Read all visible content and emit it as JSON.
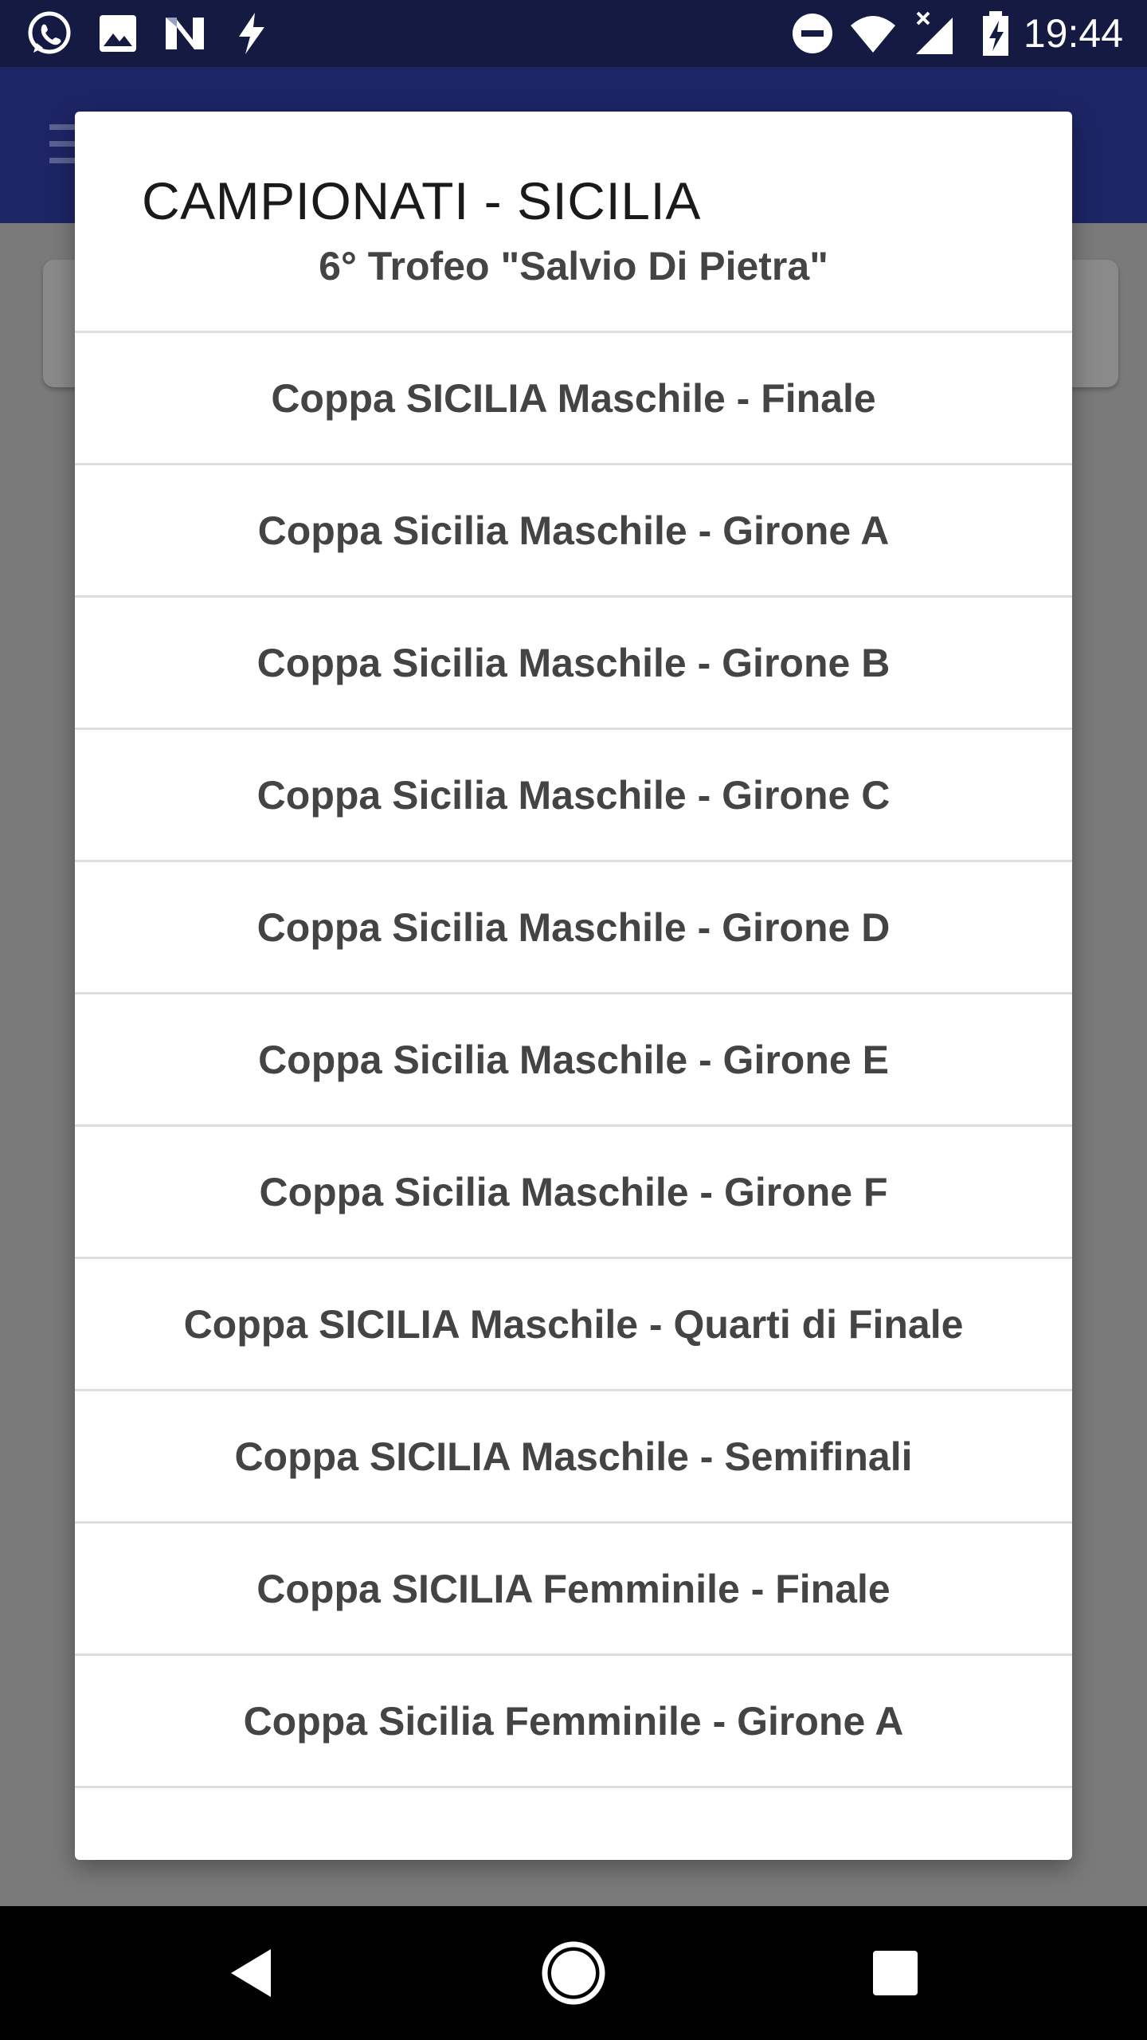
{
  "status_bar": {
    "time": "19:44",
    "left_icons": [
      "whatsapp-icon",
      "image-icon",
      "n-app-icon",
      "flash-icon"
    ],
    "right_icons": [
      "do-not-disturb-icon",
      "wifi-icon",
      "signal-icon",
      "battery-charging-icon"
    ]
  },
  "dialog": {
    "title": "CAMPIONATI - SICILIA",
    "items": [
      "6° Trofeo \"Salvio Di Pietra\"",
      "Coppa SICILIA Maschile - Finale",
      "Coppa Sicilia Maschile - Girone A",
      "Coppa Sicilia Maschile - Girone B",
      "Coppa Sicilia Maschile - Girone C",
      "Coppa Sicilia Maschile - Girone D",
      "Coppa Sicilia Maschile - Girone E",
      "Coppa Sicilia Maschile - Girone F",
      "Coppa SICILIA Maschile - Quarti di Finale",
      "Coppa SICILIA Maschile - Semifinali",
      "Coppa SICILIA Femminile - Finale",
      "Coppa Sicilia Femminile - Girone A"
    ]
  },
  "nav_bar": {
    "icons": [
      "back-icon",
      "home-icon",
      "recents-icon"
    ]
  },
  "colors": {
    "status_bar": "#141a42",
    "app_bar": "#1d2566",
    "scrim": "#7a7a7a",
    "item_text": "#444444",
    "divider": "#dedede"
  }
}
